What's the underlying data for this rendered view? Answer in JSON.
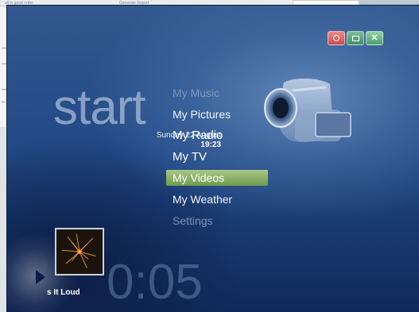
{
  "background": {
    "note_left": "all in good order",
    "note_mid": "Generate Report"
  },
  "window_controls": {
    "close_red_icon": "record-icon",
    "maximize_icon": "maximize-icon",
    "close_icon": "close-icon"
  },
  "start": {
    "title": "start",
    "date": "Sunday 22 August",
    "time": "19:23"
  },
  "menu": {
    "items": [
      {
        "label": "My Music"
      },
      {
        "label": "My Pictures"
      },
      {
        "label": "My Radio"
      },
      {
        "label": "My TV"
      },
      {
        "label": "My Videos"
      },
      {
        "label": "My Weather"
      },
      {
        "label": "Settings"
      }
    ],
    "selected_index": 4
  },
  "now_playing": {
    "track": "s It Loud",
    "elapsed": "0:05"
  },
  "colors": {
    "selection": "#8fb469",
    "background_top": "#32588f",
    "background_bottom": "#0f2a5a"
  }
}
